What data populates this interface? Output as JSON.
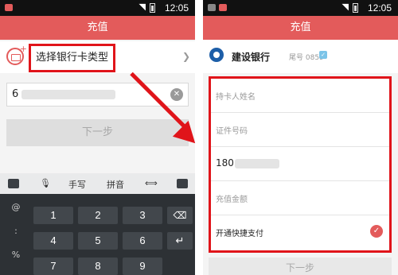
{
  "status_bar": {
    "time": "12:05"
  },
  "left_screen": {
    "title": "充值",
    "pick_bank_label": "选择银行卡类型",
    "card_number_value": "6",
    "next_label": "下一步",
    "keyboard": {
      "toolbar_handwrite": "手写",
      "toolbar_pinyin": "拼音",
      "symbols": [
        "@",
        ":",
        "%"
      ],
      "digits": [
        "1",
        "2",
        "3",
        "4",
        "5",
        "6",
        "7",
        "8",
        "9"
      ]
    }
  },
  "right_screen": {
    "title": "充值",
    "bank_name": "建设银行",
    "card_tail": "尾号 0859",
    "fields": {
      "name_placeholder": "持卡人姓名",
      "id_placeholder": "证件号码",
      "phone_value": "180",
      "amount_placeholder": "充值金额",
      "quick_pay_label": "开通快捷支付"
    },
    "next_label": "下一步"
  },
  "colors": {
    "header": "#e35b5b",
    "highlight": "#e0141a"
  },
  "icons": [
    "card-add-icon",
    "chevron-right-icon",
    "clear-icon",
    "bank-logo-icon",
    "check-icon",
    "backspace-icon",
    "enter-icon",
    "mic-icon",
    "keyboard-icon",
    "cursor-icon",
    "collapse-icon",
    "wifi-icon",
    "battery-icon"
  ]
}
